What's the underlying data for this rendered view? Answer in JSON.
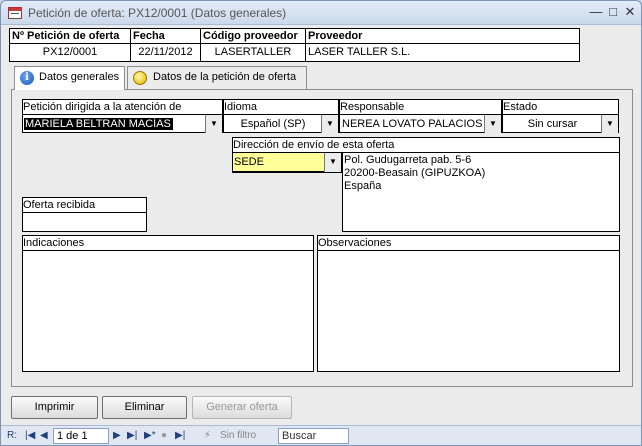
{
  "window": {
    "title": "Petición de oferta: PX12/0001 (Datos generales)"
  },
  "header": {
    "columns": [
      {
        "label": "Nº Petición de oferta",
        "value": "PX12/0001"
      },
      {
        "label": "Fecha",
        "value": "22/11/2012"
      },
      {
        "label": "Código proveedor",
        "value": "LASERTALLER"
      },
      {
        "label": "Proveedor",
        "value": "LASER TALLER S.L."
      }
    ]
  },
  "tabs": [
    {
      "label": "Datos generales",
      "icon": "info-icon",
      "active": true
    },
    {
      "label": "Datos de la petición de oferta",
      "icon": "yellow-circle-icon",
      "active": false
    }
  ],
  "form": {
    "atencion": {
      "label": "Petición dirigida a la atención de",
      "value": "MARIELA BELTRAN MACÍAS"
    },
    "idioma": {
      "label": "Idioma",
      "value": "Español (SP)"
    },
    "responsable": {
      "label": "Responsable",
      "value": "NEREA LOVATO PALACIOS"
    },
    "estado": {
      "label": "Estado",
      "value": "Sin cursar"
    },
    "direccion": {
      "label": "Dirección de envío de esta oferta",
      "value": "SEDE",
      "lines": [
        "Pol. Gudugarreta pab. 5-6",
        "20200-Beasain (GIPUZKOA)",
        "España"
      ]
    },
    "oferta_recibida": {
      "label": "Oferta recibida",
      "value": ""
    },
    "indicaciones": {
      "label": "Indicaciones",
      "value": ""
    },
    "observaciones": {
      "label": "Observaciones",
      "value": ""
    }
  },
  "buttons": {
    "imprimir": "Imprimir",
    "eliminar": "Eliminar",
    "generar": "Generar oferta"
  },
  "navigation": {
    "record_label": "R:",
    "record": "1 de 1",
    "filter": "Sin filtro",
    "search": "Buscar"
  },
  "colors": {
    "highlight_combo": "#ffff99",
    "selection": "#000000"
  }
}
